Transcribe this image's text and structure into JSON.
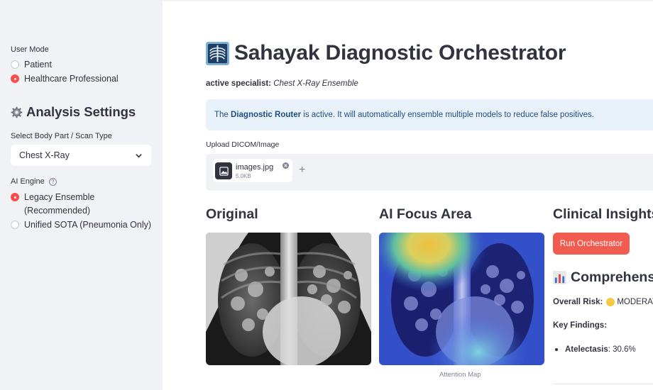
{
  "sidebar": {
    "user_mode_label": "User Mode",
    "user_modes": [
      {
        "label": "Patient",
        "selected": false
      },
      {
        "label": "Healthcare Professional",
        "selected": true
      }
    ],
    "settings_heading": "Analysis Settings",
    "settings_icon": "gear-icon",
    "scan_type_label": "Select Body Part / Scan Type",
    "scan_type_value": "Chest X-Ray",
    "ai_engine_label": "AI Engine",
    "ai_engines": [
      {
        "label": "Legacy Ensemble",
        "label2": "(Recommended)",
        "selected": true
      },
      {
        "label": "Unified SOTA (Pneumonia Only)",
        "selected": false
      }
    ]
  },
  "main": {
    "title": "Sahayak Diagnostic Orchestrator",
    "title_icon": "xray-icon",
    "specialist_label": "active specialist:",
    "specialist_value": "Chest X-Ray Ensemble",
    "info": {
      "prefix": "The",
      "strong": "Diagnostic Router",
      "suffix": "is active. It will automatically ensemble multiple models to reduce false positives."
    },
    "upload_label": "Upload DICOM/Image",
    "file": {
      "name": "images.jpg",
      "size": "5.0KB"
    },
    "columns": {
      "original": "Original",
      "focus": "AI Focus Area",
      "insights": "Clinical Insights"
    },
    "focus_caption": "Attention Map",
    "run_button": "Run Orchestrator",
    "comprehensive_heading": "Comprehens",
    "comprehensive_icon": "bar-chart-icon",
    "risk_label": "Overall Risk:",
    "risk_value": "MODERATE",
    "risk_color": "#f7c844",
    "findings_title": "Key Findings:",
    "findings": [
      {
        "name": "Atelectasis",
        "value": ": 30.6%"
      }
    ]
  },
  "colors": {
    "accent": "#ff4b4b",
    "button": "#f15b50",
    "sidebar_bg": "#f0f2f6",
    "info_bg": "#e9f1fb",
    "info_text": "#1d4f86"
  }
}
